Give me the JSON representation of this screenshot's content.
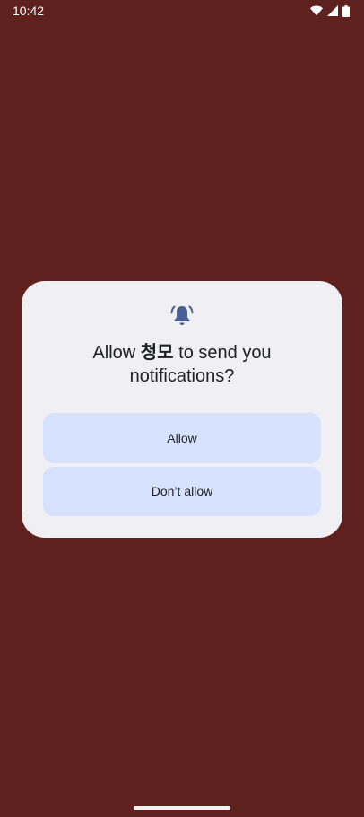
{
  "status_bar": {
    "time": "10:42",
    "icons": [
      "wifi-icon",
      "cellular-signal-icon",
      "battery-icon"
    ]
  },
  "dialog": {
    "icon": "notification-bell-icon",
    "title_prefix": "Allow ",
    "app_name": "청모",
    "title_suffix": " to send you notifications?",
    "allow_label": "Allow",
    "deny_label": "Don’t allow"
  },
  "colors": {
    "background": "#5e211d",
    "dialog": "#efeff4",
    "button": "#d7e2ff",
    "accent": "#4a5f94"
  }
}
